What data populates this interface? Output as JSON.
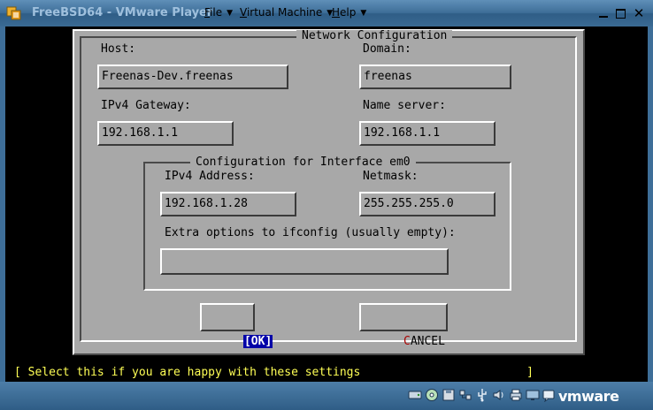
{
  "window": {
    "title": "FreeBSD64 - VMware Player",
    "menus": [
      {
        "label": "File",
        "key": "F",
        "rest": "ile"
      },
      {
        "label": "Virtual Machine",
        "key": "V",
        "rest": "irtual Machine"
      },
      {
        "label": "Help",
        "key": "H",
        "rest": "elp"
      }
    ],
    "close_glyph": "✕"
  },
  "dialog": {
    "title": "Network Configuration",
    "host": {
      "label": "Host:",
      "value": "Freenas-Dev.freenas"
    },
    "domain": {
      "label": "Domain:",
      "value": "freenas"
    },
    "gateway": {
      "label": "IPv4 Gateway:",
      "value": "192.168.1.1"
    },
    "nameserver": {
      "label": "Name server:",
      "value": "192.168.1.1"
    },
    "interface": {
      "title": "Configuration for Interface em0",
      "address": {
        "label": "IPv4 Address:",
        "value": "192.168.1.28"
      },
      "netmask": {
        "label": "Netmask:",
        "value": "255.255.255.0"
      },
      "extra": {
        "label": "Extra options to ifconfig (usually empty):",
        "value": ""
      }
    },
    "ok_button": {
      "open": "[",
      "label": "OK",
      "close": "]"
    },
    "cancel_button": {
      "hotkey": "C",
      "rest": "ANCEL"
    }
  },
  "status_line": "[ Select this if you are happy with these settings                        ]",
  "brand": {
    "logo": "vmware"
  },
  "colors": {
    "accent": "#0000a8",
    "status": "#ffff55",
    "hotkey": "#a80000",
    "panel": "#a8a8a8"
  }
}
